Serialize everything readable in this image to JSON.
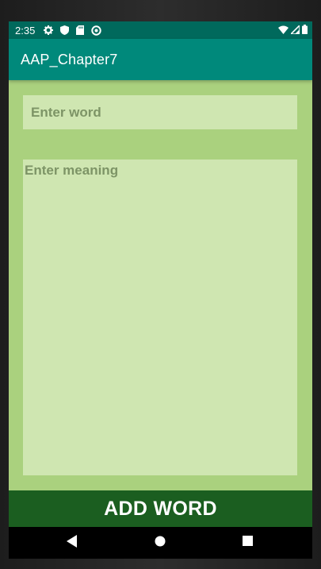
{
  "status_bar": {
    "time": "2:35",
    "left_icons": [
      "settings-icon",
      "shield-icon",
      "sd-card-icon",
      "sync-icon"
    ],
    "right_icons": [
      "wifi-icon",
      "signal-icon",
      "battery-icon"
    ]
  },
  "app_bar": {
    "title": "AAP_Chapter7"
  },
  "form": {
    "word_placeholder": "Enter word",
    "word_value": "",
    "meaning_placeholder": "Enter meaning",
    "meaning_value": "",
    "add_button_label": "ADD WORD"
  },
  "nav_bar": {
    "buttons": [
      "back-icon",
      "home-icon",
      "recents-icon"
    ]
  },
  "colors": {
    "status_bar": "#00695c",
    "app_bar": "#00897b",
    "background": "#aad17e",
    "input_background": "#cfe6b1",
    "button": "#1b5e20"
  }
}
